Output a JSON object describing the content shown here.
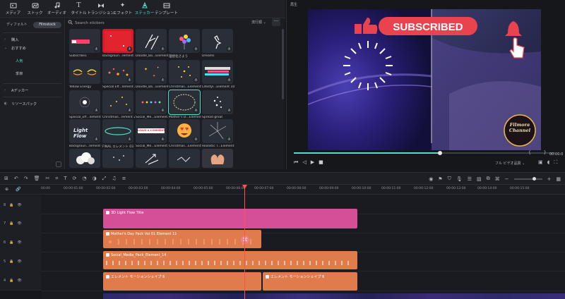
{
  "toolbar": {
    "items": [
      {
        "label": "メディア",
        "icon": "media-icon"
      },
      {
        "label": "ストック",
        "icon": "stock-icon"
      },
      {
        "label": "オーディオ",
        "icon": "audio-icon"
      },
      {
        "label": "タイトル",
        "icon": "title-icon"
      },
      {
        "label": "トランジション",
        "icon": "transition-icon"
      },
      {
        "label": "エフェクト",
        "icon": "effect-icon"
      },
      {
        "label": "ステッカー",
        "icon": "sticker-icon",
        "active": true
      },
      {
        "label": "テンプレート",
        "icon": "template-icon"
      }
    ]
  },
  "leftnav": {
    "tabs": [
      "ディフォルト",
      "Filmstock"
    ],
    "rows": [
      "購入",
      "おすすめ",
      "人気",
      "季節",
      "Aデッカー",
      "リソースパック"
    ]
  },
  "grid": {
    "search_placeholder": "Search stickers",
    "filter_label": "流行順",
    "labels": [
      "Subscribe1",
      "Backgroun...lement 36",
      "Doodle_Ba...Element 4",
      "理想化さよう",
      "Dreams",
      "Yellow Energy",
      "Special Eff...lement 21",
      "Doodle_Ba...Element 53",
      "Christmas...Element 11",
      "Lifestyl...Element 10",
      "Special_Eff...lement 21",
      "Christmas...lement 22",
      "Social_Me...Element 2",
      "Mother's D...Element 11",
      "Spread great",
      "Backgroun...lement 69",
      "FINAL エレメント 03",
      "Social_Me...Element 14",
      "Christmas...Element 40",
      "Realistic T...Element 2"
    ],
    "light_flow": "Light Flow",
    "leave_comment": "LEAVE A COMMENT"
  },
  "preview": {
    "label": "再生",
    "subscribed": "SUBSCRIBED",
    "logo_line1": "Filmora",
    "logo_line2": "Channel",
    "quality": "フル ビデオ品質",
    "time": "00:00:0"
  },
  "ruler": {
    "ticks": [
      "00:00",
      "00:00:01:00",
      "00:00:02:00",
      "00:00:03:00",
      "00:00:04:00",
      "00:00:05:00",
      "00:00:06:00",
      "00:00:07:00",
      "00:00:08:00",
      "00:00:09:00",
      "00:00:10:00",
      "00:00:11:00",
      "00:00:12:00",
      "00:00:13:00",
      "00:00:14:00",
      "00:00:15:00"
    ]
  },
  "tracks": {
    "headers": [
      "8",
      "7",
      "6",
      "5",
      "4"
    ],
    "clips": [
      "3D Light Flow Title",
      "Mother's Day Pack Vol 01 Element 11",
      "Social_Media_Pack_Element_14",
      "エレメント モーションシェイプ 6",
      "エレメント モーションシェイプ 6"
    ]
  },
  "colors": {
    "accent": "#4fe0c9",
    "pink_clip": "#d44f96",
    "orange_clip": "#e07b4c",
    "playhead": "#ff5247"
  }
}
